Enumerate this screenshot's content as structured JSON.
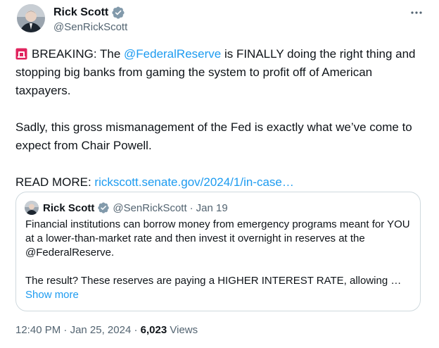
{
  "author": {
    "name": "Rick Scott",
    "handle": "@SenRickScott"
  },
  "tweet": {
    "p1_prefix": "BREAKING: The ",
    "p1_mention": "@FederalReserve",
    "p1_suffix": " is FINALLY doing the right thing and stopping big banks from gaming the system to profit off of American taxpayers.",
    "p2": "Sadly, this gross mismanagement of the Fed is exactly what we’ve come to expect from Chair Powell.",
    "p3_prefix": "READ MORE: ",
    "p3_link": "rickscott.senate.gov/2024/1/in-case…"
  },
  "quote": {
    "name": "Rick Scott",
    "handle": "@SenRickScott",
    "separator": "·",
    "date": "Jan 19",
    "p1": "Financial institutions can borrow money from emergency programs meant for YOU at a lower-than-market rate and then invest it overnight in reserves at the @FederalReserve.",
    "p2": "The result? These reserves are paying a HIGHER INTEREST RATE, allowing …",
    "show_more": "Show more"
  },
  "footer": {
    "time": "12:40 PM",
    "separator": "·",
    "date": "Jan 25, 2024",
    "views_count": "6,023",
    "views_label": "Views"
  },
  "colors": {
    "accent": "#1d9bf0",
    "muted": "#536471",
    "text": "#0f1419",
    "border": "#cfd9de"
  },
  "icons": [
    "verified-badge-icon",
    "more-options-icon",
    "siren-emoji-icon"
  ]
}
